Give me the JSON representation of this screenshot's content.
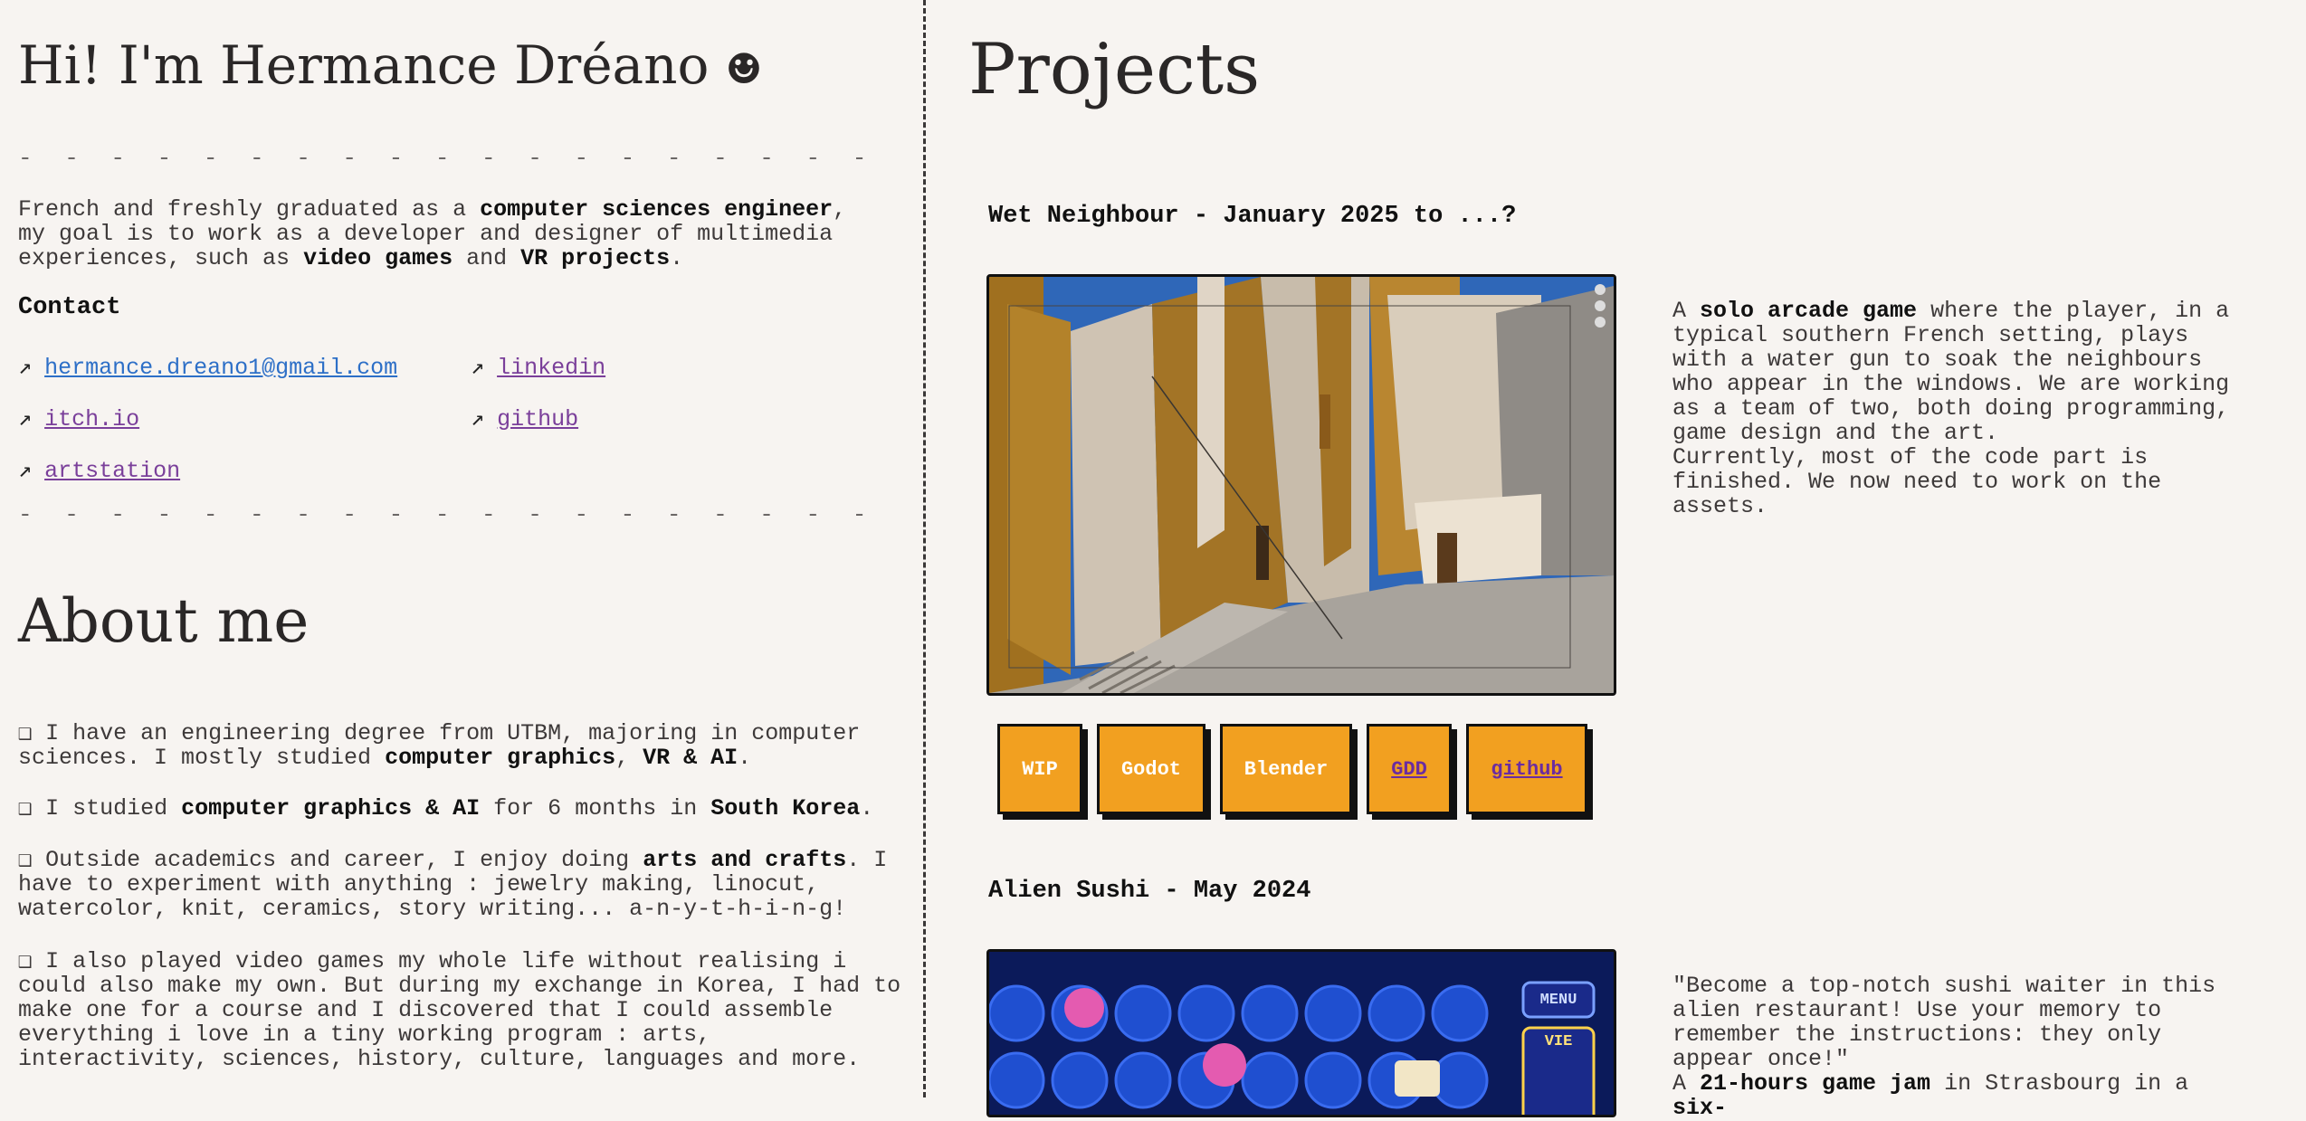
{
  "header": {
    "name": "Hi! I'm Hermance Dréano",
    "smile": "☻"
  },
  "dashes": "- - - - - - - - - - - - - - - - - - - - - - - - - - - - - - - - - - - - -",
  "intro": {
    "p1": "French and freshly graduated as a ",
    "b1": "computer sciences engineer",
    "p2": ", my goal is to work as a developer and designer of multimedia experiences, such as ",
    "b2": "video games",
    "p3": " and ",
    "b3": "VR projects",
    "p4": "."
  },
  "contact": {
    "title": "Contact",
    "arrow": "↗",
    "email": "hermance.dreano1@gmail.com",
    "linkedin": "linkedin",
    "itch": "itch.io",
    "github": "github",
    "artstation": "artstation"
  },
  "about": {
    "title": "About me",
    "box": "❑",
    "b1": {
      "t1": "I have an engineering degree from UTBM, majoring in computer sciences. I mostly studied ",
      "s1": "computer graphics",
      "t2": ", ",
      "s2": "VR & AI",
      "t3": "."
    },
    "b2": {
      "t1": "I studied ",
      "s1": "computer graphics & AI",
      "t2": " for 6 months in ",
      "s2": "South Korea",
      "t3": "."
    },
    "b3": {
      "t1": "Outside academics and career, I enjoy doing ",
      "s1": "arts and crafts",
      "t2": ". I have to experiment with anything : jewelry making, linocut, watercolor, knit, ceramics, story writing... a-n-y-t-h-i-n-g!"
    },
    "b4": {
      "t1": "I also played video games my whole life without realising i could also make my own. But during my exchange in Korea, I had to make one for a course and I discovered that I could assemble everything i love in a tiny working program : arts, interactivity, sciences, history, culture, languages and more."
    }
  },
  "projects": {
    "title": "Projects",
    "p1": {
      "title": "Wet Neighbour - January 2025 to ...?",
      "d1": "A ",
      "b1": "solo arcade game",
      "d2": " where the player, in a typical southern French setting, plays with a water gun to soak the neighbours who appear in the windows. We are working as a team of two, both doing programming, game design and the art.",
      "d3": "Currently, most of the code part is finished. We now need to work on the assets.",
      "tags": [
        "WIP",
        "Godot",
        "Blender",
        "GDD",
        "github"
      ]
    },
    "p2": {
      "title": "Alien Sushi - May 2024",
      "quote": "\"Become a top-notch sushi waiter in this alien restaurant! Use your memory to remember the instructions: they only appear once!\"",
      "d1": "A ",
      "b1": "21-hours game jam",
      "d2": " in Strasbourg in a ",
      "b2": "six-",
      "menu": "MENU",
      "vie": "VIE"
    }
  }
}
